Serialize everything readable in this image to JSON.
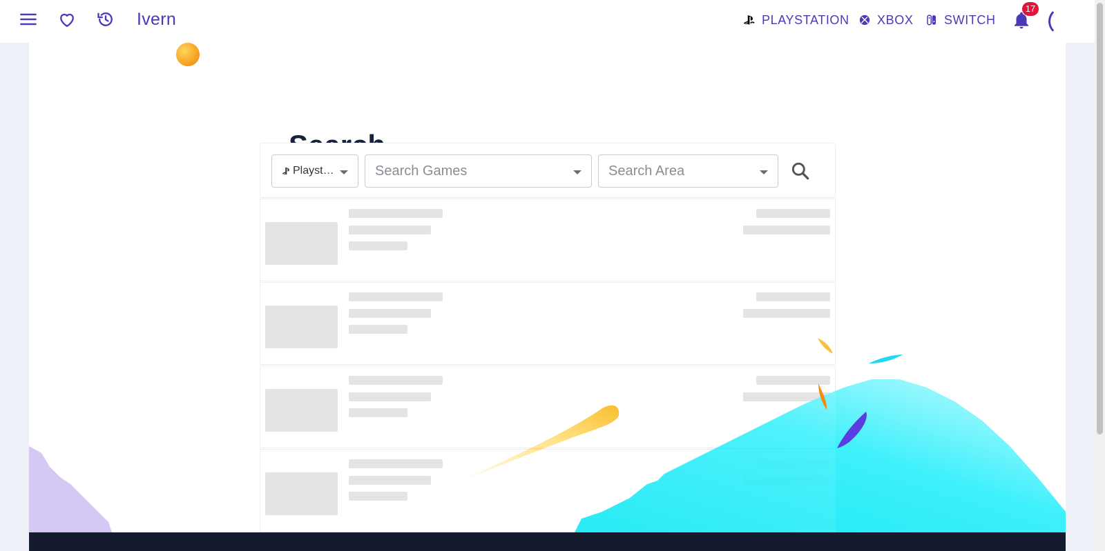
{
  "header": {
    "brand": "Ivern",
    "menu_icon": "hamburger-menu-icon",
    "favorites_icon": "heart-icon",
    "history_icon": "history-icon",
    "platforms": [
      {
        "label": "PLAYSTATION",
        "icon": "playstation-icon"
      },
      {
        "label": "XBOX",
        "icon": "xbox-icon"
      },
      {
        "label": "SWITCH",
        "icon": "switch-icon"
      }
    ],
    "notifications_count": "17",
    "accent_color": "#4a3ab8",
    "badge_color": "#e3143b"
  },
  "page": {
    "title": "Search"
  },
  "search": {
    "platform_value": "Playst…",
    "games_placeholder": "Search Games",
    "area_placeholder": "Search Area"
  },
  "results": {
    "loading_placeholders": 4
  },
  "colors": {
    "footer": "#141b2e",
    "page_background": "#eef0f7",
    "wave": "#20e6f5"
  }
}
